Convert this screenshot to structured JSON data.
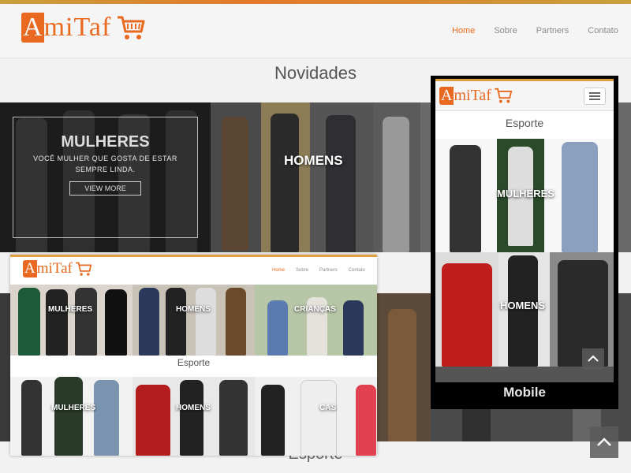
{
  "brand": {
    "name_first": "A",
    "name_rest": "miTaf",
    "name_rest_tail": "Taf",
    "accent": "#e8691f"
  },
  "nav": {
    "items": [
      {
        "label": "Home",
        "active": true
      },
      {
        "label": "Sobre",
        "active": false
      },
      {
        "label": "Partners",
        "active": false
      },
      {
        "label": "Contato",
        "active": false
      }
    ]
  },
  "main": {
    "section_title": "Novidades",
    "promo": {
      "title": "MULHERES",
      "subtitle_line1": "VOCÊ MULHER QUE GOSTA DE ESTAR",
      "subtitle_line2": "SEMPRE LINDA.",
      "button": "VIEW MORE"
    },
    "men_label": "HOMENS",
    "footer_title": "Esporte"
  },
  "desktop_preview": {
    "nav": [
      "Home",
      "Sobre",
      "Partners",
      "Contato"
    ],
    "categories": [
      "MULHERES",
      "HOMENS",
      "CRIANÇAS"
    ],
    "section_title": "Esporte",
    "sport_labels": [
      "MULHERES",
      "HOMENS",
      "CAS"
    ]
  },
  "mobile_preview": {
    "section_title": "Esporte",
    "labels": [
      "MULHERES",
      "HOMENS"
    ],
    "caption": "Mobile"
  },
  "icons": [
    "cart-icon",
    "hamburger-menu-icon",
    "chevron-up-icon"
  ]
}
